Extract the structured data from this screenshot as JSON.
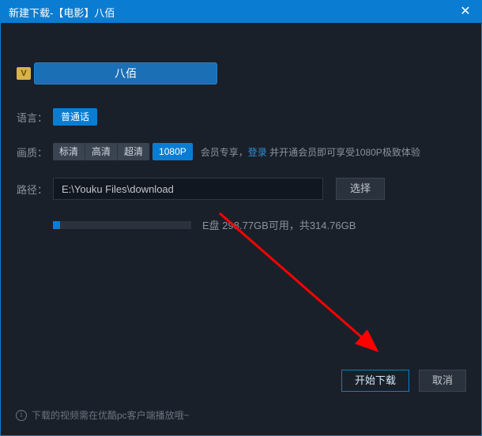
{
  "titlebar": {
    "title": "新建下载-【电影】八佰"
  },
  "movie": {
    "vip_badge": "V",
    "name": "八佰"
  },
  "labels": {
    "language": "语言：",
    "quality": "画质：",
    "path": "路径："
  },
  "language": {
    "value": "普通话"
  },
  "quality": {
    "options": [
      "标清",
      "高清",
      "超清"
    ],
    "hd1080": "1080P",
    "vip_prefix": "会员专享，",
    "login": "登录",
    "vip_suffix": " 并开通会员即可享受1080P极致体验"
  },
  "path": {
    "value": "E:\\Youku Files\\download",
    "choose": "选择"
  },
  "disk": {
    "used_percent": 5,
    "text": "E盘 298.77GB可用，共314.76GB"
  },
  "buttons": {
    "start": "开始下载",
    "cancel": "取消"
  },
  "note": {
    "icon": "i",
    "text": "下载的视频需在优酷pc客户端播放哦~"
  }
}
